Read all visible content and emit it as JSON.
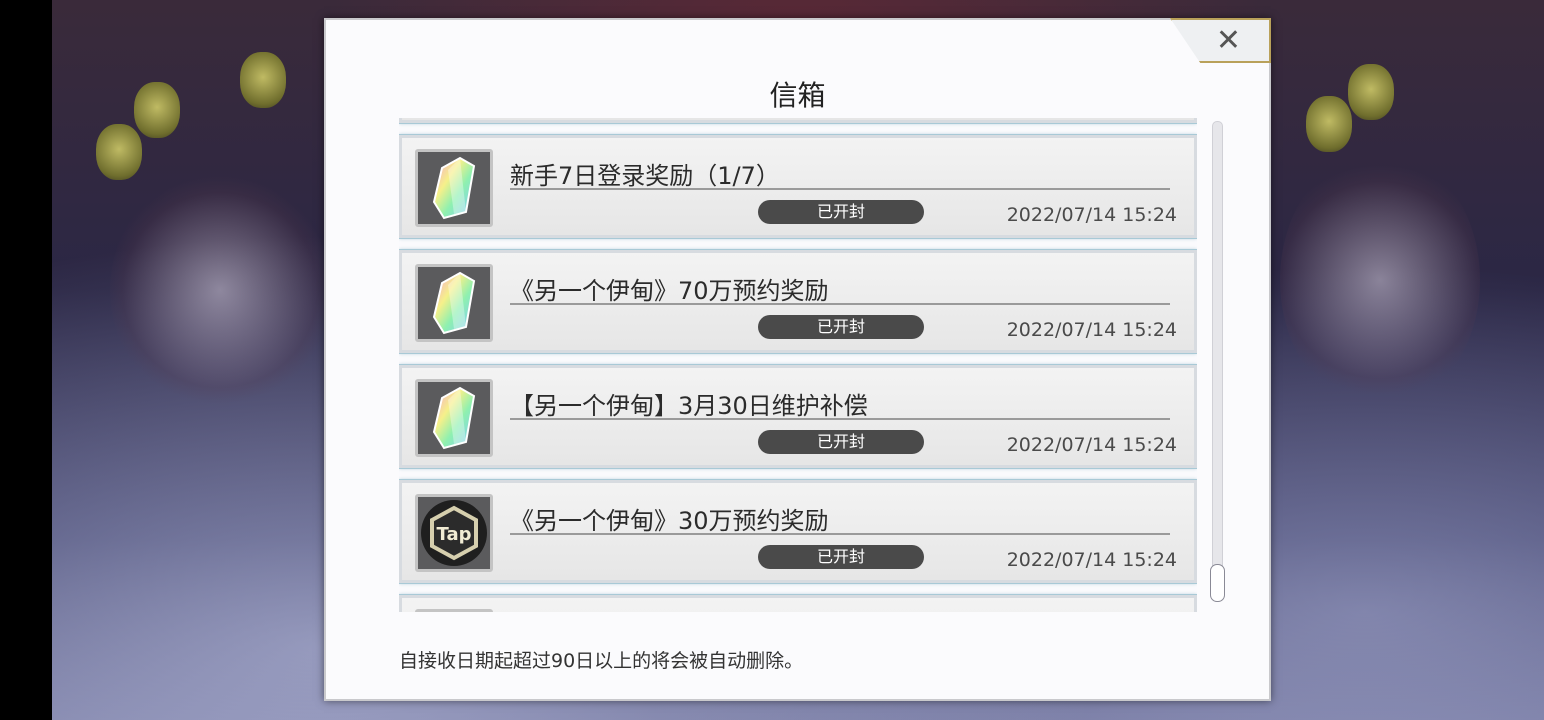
{
  "window": {
    "title": "信箱",
    "close_label": "✕"
  },
  "mails": [
    {
      "title": "新手7日登录奖励（1/7）",
      "status": "已开封",
      "date": "2022/07/14 15:24",
      "icon": "crystal-icon"
    },
    {
      "title": "《另一个伊甸》70万预约奖励",
      "status": "已开封",
      "date": "2022/07/14 15:24",
      "icon": "crystal-icon"
    },
    {
      "title": "【另一个伊甸】3月30日维护补偿",
      "status": "已开封",
      "date": "2022/07/14 15:24",
      "icon": "crystal-icon"
    },
    {
      "title": "《另一个伊甸》30万预约奖励",
      "status": "已开封",
      "date": "2022/07/14 15:24",
      "icon": "tap-icon"
    }
  ],
  "tap_icon_text": "Tap",
  "footer_note": "自接收日期起超过90日以上的将会被自动删除。",
  "colors": {
    "accent": "#b9a15a",
    "pill": "#4a4a4a",
    "panel": "#fbfbfd"
  }
}
